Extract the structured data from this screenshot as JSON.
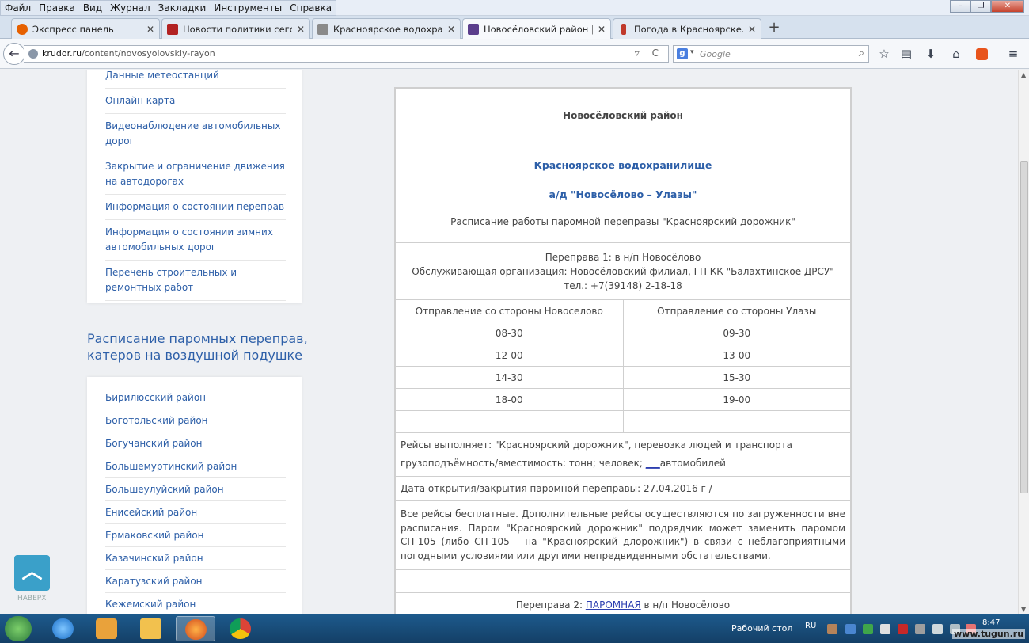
{
  "menubar": {
    "items": [
      "Файл",
      "Правка",
      "Вид",
      "Журнал",
      "Закладки",
      "Инструменты",
      "Справка"
    ]
  },
  "tabs": [
    {
      "label": "Экспресс панель",
      "icon": "firefox-icon",
      "color": "#e66000",
      "active": false
    },
    {
      "label": "Новости политики сегодн...",
      "icon": "news-icon",
      "color": "#b22222",
      "active": false
    },
    {
      "label": "Красноярское водохрани...",
      "icon": "pen-icon",
      "color": "#8a8a8a",
      "active": false
    },
    {
      "label": "Новосёловский район | К...",
      "icon": "krudor-icon",
      "color": "#5b3e8c",
      "active": true
    },
    {
      "label": "Погода в Красноярске. П...",
      "icon": "thermometer-icon",
      "color": "#c0392b",
      "active": false
    }
  ],
  "navbar": {
    "url_host": "krudor.ru",
    "url_path": "/content/novosyolovskiy-rayon",
    "search_engine": "g",
    "search_placeholder": "Google"
  },
  "sidebar_top": {
    "links": [
      "Данные метеостанций",
      "Онлайн карта",
      "Видеонаблюдение автомобильных дорог",
      "Закрытие и ограничение движения на автодорогах",
      "Информация о состоянии переправ",
      "Информация о состоянии зимних автомобильных дорог",
      "Перечень строительных и ремонтных работ"
    ]
  },
  "sidebar_ferry": {
    "heading": "Расписание паромных переправ, катеров на воздушной подушке",
    "districts": [
      "Бирилюсский район",
      "Боготольский район",
      "Богучанский район",
      "Большемуртинский район",
      "Большеулуйский район",
      "Енисейский район",
      "Ермаковский район",
      "Казачинский район",
      "Каратузский район",
      "Кежемский район"
    ]
  },
  "scroll_top": {
    "label": "НАВЕРХ"
  },
  "content": {
    "district_title": "Новосёловский район",
    "reservoir": "Красноярское водохранилище",
    "road": "а/д \"Новосёлово – Улазы\"",
    "schedule_caption": "Расписание работы паромной переправы \"Красноярский дорожник\"",
    "crossing1": {
      "line": "Переправа 1:  в н/п Новосёлово",
      "org": "Обслуживающая организация: Новосёловский филиал, ГП КК \"Балахтинское ДРСУ\"",
      "phone": "тел.: +7(39148) 2-18-18"
    },
    "table": {
      "col1": "Отправление со стороны Новоселово",
      "col2": "Отправление со стороны Улазы",
      "rows": [
        [
          "08-30",
          "09-30"
        ],
        [
          "12-00",
          "13-00"
        ],
        [
          "14-30",
          "15-30"
        ],
        [
          "18-00",
          "19-00"
        ],
        [
          "",
          ""
        ]
      ]
    },
    "ferry_info": {
      "line1": "Рейсы выполняет: \"Красноярский дорожник\", перевозка людей и транспорта",
      "line2_prefix": "грузоподъёмность/вместимость:  тонн;  человек; ",
      "line2_link": "___",
      "line2_suffix": "автомобилей"
    },
    "dates": "Дата открытия/закрытия паромной переправы: 27.04.2016 г /",
    "notes": "Все рейсы бесплатные. Дополнительные рейсы осуществляются по загруженности вне расписания. Паром \"Красноярский дорожник\" подрядчик может заменить паромом СП-105 (либо СП-105 – на \"Красноярский длорожник\") в связи с неблагоприятными погодными условиями или другими непредвиденными обстательствами.",
    "crossing2": {
      "prefix": "Переправа 2: ",
      "link": "ПАРОМНАЯ",
      "suffix": " в н/п Новосёлово"
    }
  },
  "taskbar": {
    "desktop_label": "Рабочий стол",
    "lang": "RU",
    "time": "8:47",
    "watermark": "www.tugun.ru"
  },
  "colors": {
    "link_blue": "#2d5fa8",
    "taskbar": "#1d5a8c",
    "scroll_top_button": "#3aa0c9"
  }
}
